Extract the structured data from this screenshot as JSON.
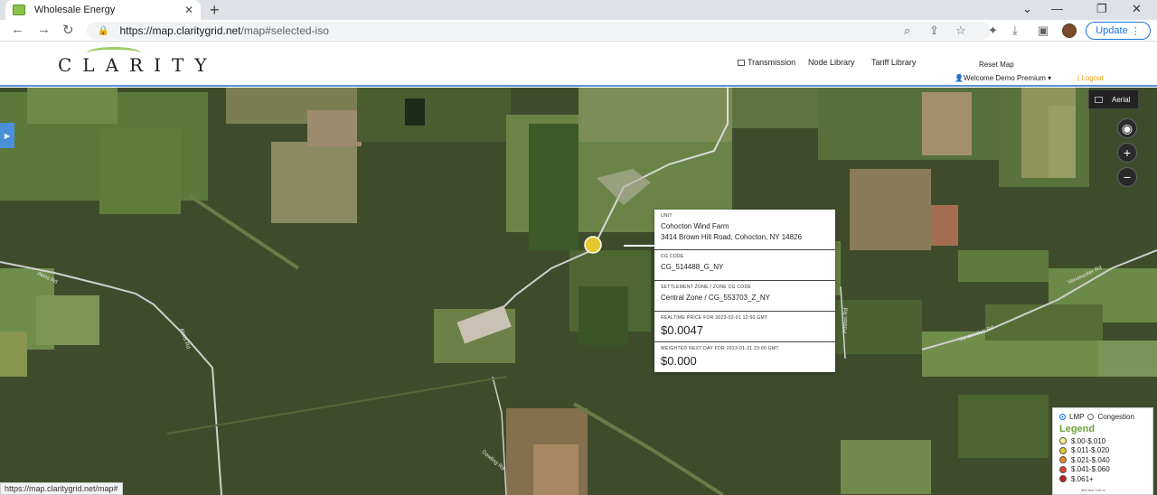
{
  "browser": {
    "tab_title": "Wholesale Energy",
    "tab_close": "✕",
    "new_tab": "+",
    "url_host": "https://map.claritygrid.net",
    "url_path": "/map#selected-iso",
    "update_label": "Update",
    "status_url": "https://map.claritygrid.net/map#"
  },
  "header": {
    "logo_text": "CLARITY",
    "transmission_label": "Transmission",
    "node_library_label": "Node Library",
    "tariff_library_label": "Tariff Library",
    "reset_map_label": "Reset Map",
    "welcome_label": "Welcome Demo Premium",
    "logout_label": "| Logout"
  },
  "map": {
    "aerial_label": "Aerial",
    "zoom_in": "+",
    "zoom_out": "−",
    "road_labels": [
      "Akins Rd",
      "Vanasucker Rd",
      "Vanasucker Rd",
      "Poston Rd",
      "Akins Rd",
      "Dowling Rd"
    ]
  },
  "popup": {
    "unit_label": "UNIT",
    "unit_name": "Cohocton Wind Farm",
    "unit_address": "3414 Brown Hill Road, Cohocton, NY 14826",
    "cg_code_label": "CG CODE",
    "cg_code": "CG_514488_G_NY",
    "zone_label": "SETTLEMENT ZONE / ZONE CG CODE",
    "zone_value": "Central Zone / CG_553703_Z_NY",
    "realtime_label": "REALTIME PRICE FOR 2023-02-01 12:50 GMT",
    "realtime_price": "$0.0047",
    "nextday_label": "WEIGHTED NEXT DAY FOR 2023-01-31 23:00 GMT",
    "nextday_price": "$0.000"
  },
  "legend": {
    "lmp_label": "LMP",
    "congestion_label": "Congestion",
    "title": "Legend",
    "items": [
      {
        "label": "$.00-$.010",
        "color": "#f5f08a"
      },
      {
        "label": "$.011-$.020",
        "color": "#e6c830"
      },
      {
        "label": "$.021-$.040",
        "color": "#e8892a"
      },
      {
        "label": "$.041-$.060",
        "color": "#d9442a"
      },
      {
        "label": "$.061+",
        "color": "#b8201e"
      }
    ],
    "scale_text": "500 feet        100 m"
  }
}
